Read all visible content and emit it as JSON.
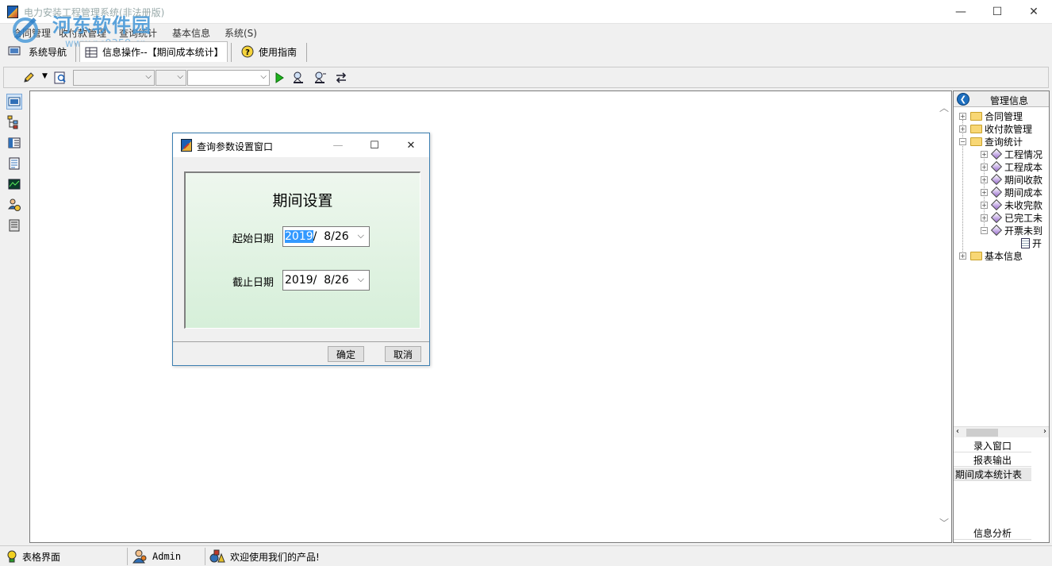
{
  "window": {
    "title": "电力安装工程管理系统(非法册版)",
    "watermark_main": "河东软件园",
    "watermark_sub": "www.pc0359.cn"
  },
  "menu": [
    "合同管理",
    "收付款管理",
    "查询统计",
    "基本信息",
    "系统(S)"
  ],
  "tabs": [
    {
      "label": "系统导航",
      "icon": "monitor-icon"
    },
    {
      "label": "信息操作--【期间成本统计】",
      "icon": "grid-icon",
      "active": true
    },
    {
      "label": "使用指南",
      "icon": "help-icon"
    }
  ],
  "toolbar": {
    "combo1": "",
    "combo2": "",
    "combo3": ""
  },
  "dialog": {
    "title": "查询参数设置窗口",
    "heading": "期间设置",
    "start_label": "起始日期",
    "start_year": "2019",
    "start_rest": "/  8/26",
    "end_label": "截止日期",
    "end_value": "2019/  8/26",
    "ok": "确定",
    "cancel": "取消"
  },
  "right_panel": {
    "header": "管理信息",
    "tree": [
      {
        "label": "合同管理",
        "level": 0,
        "type": "folder"
      },
      {
        "label": "收付款管理",
        "level": 0,
        "type": "folder"
      },
      {
        "label": "查询统计",
        "level": 0,
        "type": "folder",
        "expanded": true
      },
      {
        "label": "工程情况",
        "level": 1,
        "type": "item"
      },
      {
        "label": "工程成本",
        "level": 1,
        "type": "item"
      },
      {
        "label": "期间收款",
        "level": 1,
        "type": "item"
      },
      {
        "label": "期间成本",
        "level": 1,
        "type": "item"
      },
      {
        "label": "未收完款",
        "level": 1,
        "type": "item"
      },
      {
        "label": "已完工未",
        "level": 1,
        "type": "item"
      },
      {
        "label": "开票未到",
        "level": 1,
        "type": "item",
        "expanded": true
      },
      {
        "label": "开",
        "level": 2,
        "type": "doc"
      },
      {
        "label": "基本信息",
        "level": 0,
        "type": "folder"
      }
    ],
    "buttons": [
      "录入窗口",
      "报表输出",
      "期间成本统计表"
    ],
    "bottom_button": "信息分析"
  },
  "status": {
    "mode": "表格界面",
    "user": "Admin",
    "message": "欢迎使用我们的产品!"
  }
}
